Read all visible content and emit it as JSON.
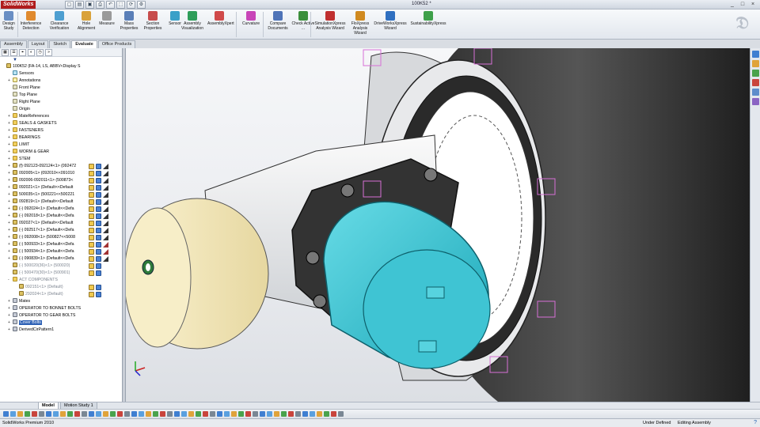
{
  "app": {
    "logo": "SolidWorks",
    "doc_title": "100K52 *",
    "window_controls": [
      "_",
      "□",
      "×"
    ]
  },
  "quick_access": [
    "new-icon",
    "open-icon",
    "save-icon",
    "print-icon",
    "undo-icon",
    "select-icon",
    "rebuild-icon",
    "options-icon"
  ],
  "quick_access_glyphs": [
    "▢",
    "▤",
    "▣",
    "⎙",
    "↶",
    "⬚",
    "⟳",
    "⚙"
  ],
  "ribbon": {
    "buttons": [
      {
        "label": "Design Study",
        "icon": "design-study-icon",
        "color": "#6a8fc4"
      },
      {
        "label": "Interference Detection",
        "icon": "interference-icon",
        "color": "#e08a2e"
      },
      {
        "label": "Clearance Verification",
        "icon": "clearance-icon",
        "color": "#4e9fd1"
      },
      {
        "label": "Hole Alignment",
        "icon": "hole-align-icon",
        "color": "#d9a23a"
      },
      {
        "label": "Measure",
        "icon": "measure-icon",
        "color": "#9a9a9a"
      },
      {
        "label": "Mass Properties",
        "icon": "mass-icon",
        "color": "#5a7fb8"
      },
      {
        "label": "Section Properties",
        "icon": "section-icon",
        "color": "#c74c4c"
      },
      {
        "label": "Sensor",
        "icon": "sensor-icon",
        "color": "#3aa0c8"
      },
      {
        "label": "Assembly Visualization",
        "icon": "asm-vis-icon",
        "color": "#2f9e5a"
      },
      {
        "label": "AssemblyXpert",
        "icon": "asmxpert-icon",
        "color": "#d04a4a"
      },
      {
        "label": "Curvature",
        "icon": "curvature-icon",
        "color": "#c845b8"
      },
      {
        "label": "Compare Documents",
        "icon": "compare-icon",
        "color": "#4f74b8"
      },
      {
        "label": "Check Active ...",
        "icon": "check-icon",
        "color": "#3b8f3b"
      },
      {
        "label": "SimulationXpress Analysis Wizard",
        "icon": "simxpress-icon",
        "color": "#c03030"
      },
      {
        "label": "FloXpress Analysis Wizard",
        "icon": "floxpress-icon",
        "color": "#d08a20"
      },
      {
        "label": "DriveWorksXpress Wizard",
        "icon": "driveworks-icon",
        "color": "#2f6fc0"
      },
      {
        "label": "SustainabilityXpress",
        "icon": "sustain-icon",
        "color": "#3ea04a"
      }
    ]
  },
  "cm_tabs": [
    {
      "label": "Assembly"
    },
    {
      "label": "Layout"
    },
    {
      "label": "Sketch"
    },
    {
      "label": "Evaluate",
      "active": true
    },
    {
      "label": "Office Products"
    }
  ],
  "panel_tools": [
    "▦",
    "☰",
    "⌖",
    "◐",
    "◷",
    "»"
  ],
  "filter": "▼",
  "tree": [
    {
      "text": "100K52  (FA-14, LS, ABBV<Display S",
      "icon": "ic-part",
      "indent": 0,
      "toggle": ""
    },
    {
      "text": "Sensors",
      "icon": "ic-sensor",
      "indent": 1,
      "toggle": ""
    },
    {
      "text": "Annotations",
      "icon": "ic-note",
      "indent": 1,
      "toggle": "+"
    },
    {
      "text": "Front Plane",
      "icon": "ic-plane",
      "indent": 1,
      "toggle": ""
    },
    {
      "text": "Top Plane",
      "icon": "ic-plane",
      "indent": 1,
      "toggle": ""
    },
    {
      "text": "Right Plane",
      "icon": "ic-plane",
      "indent": 1,
      "toggle": ""
    },
    {
      "text": "Origin",
      "icon": "ic-plane",
      "indent": 1,
      "toggle": ""
    },
    {
      "text": "MateReferences",
      "icon": "ic-folder",
      "indent": 1,
      "toggle": "+"
    },
    {
      "text": "SEALS & GASKETS",
      "icon": "ic-folder",
      "indent": 1,
      "toggle": "+"
    },
    {
      "text": "FASTENERS",
      "icon": "ic-folder",
      "indent": 1,
      "toggle": "+"
    },
    {
      "text": "BEARINGS",
      "icon": "ic-folder",
      "indent": 1,
      "toggle": "+"
    },
    {
      "text": "LIMIT",
      "icon": "ic-folder",
      "indent": 1,
      "toggle": "+"
    },
    {
      "text": "WORM & GEAR",
      "icon": "ic-folder",
      "indent": 1,
      "toggle": "+"
    },
    {
      "text": "STEM",
      "icon": "ic-folder",
      "indent": 1,
      "toggle": "+"
    },
    {
      "text": "(f) 092123-092124<1> (092472",
      "icon": "ic-part",
      "indent": 1,
      "toggle": "+",
      "cols": "ybt"
    },
    {
      "text": "092005<1> (092010<<091010",
      "icon": "ic-part",
      "indent": 1,
      "toggle": "+",
      "cols": "ybt"
    },
    {
      "text": "092006-092011<1> (500873<",
      "icon": "ic-part",
      "indent": 1,
      "toggle": "+",
      "cols": "ybt"
    },
    {
      "text": "092021<1> (Default<<Default",
      "icon": "ic-part",
      "indent": 1,
      "toggle": "+",
      "cols": "ybt"
    },
    {
      "text": "500035<1> (500221<<500221",
      "icon": "ic-part",
      "indent": 1,
      "toggle": "+",
      "cols": "ybt"
    },
    {
      "text": "092819<1> (Default<<Default",
      "icon": "ic-part",
      "indent": 1,
      "toggle": "+",
      "cols": "ybt"
    },
    {
      "text": "(-) 092024<1> (Default<<Defa",
      "icon": "ic-part",
      "indent": 1,
      "toggle": "+",
      "cols": "ybt"
    },
    {
      "text": "(-) 092018<1> (Default<<Defa",
      "icon": "ic-part",
      "indent": 1,
      "toggle": "+",
      "cols": "ybt"
    },
    {
      "text": "092027<1> (Default<<Default",
      "icon": "ic-part",
      "indent": 1,
      "toggle": "+",
      "cols": "ybt"
    },
    {
      "text": "(-) 092517<1> (Default<<Defa",
      "icon": "ic-part",
      "indent": 1,
      "toggle": "+",
      "cols": "ybt"
    },
    {
      "text": "(-) 092008<1> (500827<<5008",
      "icon": "ic-part",
      "indent": 1,
      "toggle": "+",
      "cols": "ybt"
    },
    {
      "text": "(-) 500933<1> (Default<<Defa",
      "icon": "ic-part",
      "indent": 1,
      "toggle": "+",
      "cols": "ybr"
    },
    {
      "text": "(-) 500934<1> (Default<<Defa",
      "icon": "ic-part",
      "indent": 1,
      "toggle": "+",
      "cols": "ybr"
    },
    {
      "text": "(-) 090839<1> (Default<<Defa",
      "icon": "ic-part",
      "indent": 1,
      "toggle": "+",
      "cols": "ybt"
    },
    {
      "text": "(-) 500020(36)<1> (500020)",
      "icon": "ic-part",
      "indent": 1,
      "toggle": "",
      "dim": true,
      "cols": "yb"
    },
    {
      "text": "(-) 500470(30)<1> (500901)",
      "icon": "ic-part",
      "indent": 1,
      "toggle": "",
      "dim": true,
      "cols": "yb"
    },
    {
      "text": "ACT COMPONENTS",
      "icon": "ic-folder",
      "indent": 1,
      "toggle": "-",
      "dim": true
    },
    {
      "text": "092151<1> (Default)",
      "icon": "ic-part",
      "indent": 2,
      "toggle": "",
      "dim": true,
      "cols": "yb"
    },
    {
      "text": "292024<1> (Default)",
      "icon": "ic-part",
      "indent": 2,
      "toggle": "",
      "dim": true,
      "cols": "yb"
    },
    {
      "text": "Mates",
      "icon": "ic-mate",
      "indent": 1,
      "toggle": "+"
    },
    {
      "text": "OPERATOR TO BONNET BOLTS",
      "icon": "ic-mate",
      "indent": 1,
      "toggle": "+"
    },
    {
      "text": "OPERATOR TO GEAR BOLTS",
      "icon": "ic-mate",
      "indent": 1,
      "toggle": "+"
    },
    {
      "text": "Cover Bolts",
      "icon": "ic-mate",
      "indent": 1,
      "toggle": "+",
      "sel": true
    },
    {
      "text": "DerivedCirPattern1",
      "icon": "ic-mate",
      "indent": 1,
      "toggle": "+"
    }
  ],
  "bottom_tabs": [
    {
      "label": "Model",
      "active": true
    },
    {
      "label": "Motion Study 1"
    }
  ],
  "status": {
    "app": "SolidWorks Premium 2010",
    "state": "Under Defined",
    "mode": "Editing Assembly",
    "help": "?"
  },
  "taskpane_colors": [
    "#3f7fd1",
    "#e0a33a",
    "#49a34c",
    "#c9443c",
    "#5d8ccb",
    "#8a63c3"
  ]
}
